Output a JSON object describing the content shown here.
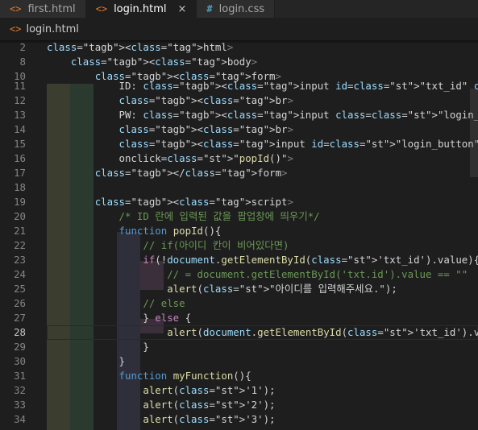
{
  "tabs": [
    {
      "icon": "<>",
      "label": "first.html",
      "active": false
    },
    {
      "icon": "<>",
      "label": "login.html",
      "active": true,
      "close": "×"
    },
    {
      "icon": "#",
      "label": "login.css",
      "active": false
    }
  ],
  "breadcrumb": {
    "icon": "<>",
    "file": "login.html"
  },
  "lines": [
    {
      "n": "2",
      "t": "<html>"
    },
    {
      "n": "8",
      "t": "    <body>"
    },
    {
      "n": "10",
      "t": "        <form>"
    },
    {
      "n": "11",
      "t": "            ID: <input id=\"txt_id\" class=\"login_inputs\" type=\"text\">"
    },
    {
      "n": "12",
      "t": "            <br>"
    },
    {
      "n": "13",
      "t": "            PW: <input class=\"login_inputs\" type=\"password\">"
    },
    {
      "n": "14",
      "t": "            <br>"
    },
    {
      "n": "15",
      "t": "            <input id=\"login_button\" type=\"button\" value=\"login\""
    },
    {
      "n": "16",
      "t": "            onclick=\"popId()\">"
    },
    {
      "n": "17",
      "t": "        </form>"
    },
    {
      "n": "18",
      "t": ""
    },
    {
      "n": "19",
      "t": "        <script>"
    },
    {
      "n": "20",
      "t": "            /* ID 란에 입력된 값을 팝업창에 띄우기*/"
    },
    {
      "n": "21",
      "t": "            function popId(){"
    },
    {
      "n": "22",
      "t": "                // if(아이디 칸이 비어있다면)"
    },
    {
      "n": "23",
      "t": "                if(!document.getElementById('txt_id').value){"
    },
    {
      "n": "24",
      "t": "                    // = document.getElementById('txt.id').value == \"\""
    },
    {
      "n": "25",
      "t": "                    alert(\"아이디를 입력해주세요.\");"
    },
    {
      "n": "26",
      "t": "                // else"
    },
    {
      "n": "27",
      "t": "                } else {"
    },
    {
      "n": "28",
      "t": "                    alert(document.getElementById('txt_id').value);"
    },
    {
      "n": "29",
      "t": "                }"
    },
    {
      "n": "30",
      "t": "            }"
    },
    {
      "n": "31",
      "t": "            function myFunction(){"
    },
    {
      "n": "32",
      "t": "                alert('1');"
    },
    {
      "n": "33",
      "t": "                alert('2');"
    },
    {
      "n": "34",
      "t": "                alert('3');"
    }
  ],
  "current_line": "28",
  "colors": {
    "background": "#1e1e1e",
    "keyword": "#569cd6",
    "string": "#ce9178",
    "comment": "#6a9955",
    "function": "#dcdcaa"
  }
}
